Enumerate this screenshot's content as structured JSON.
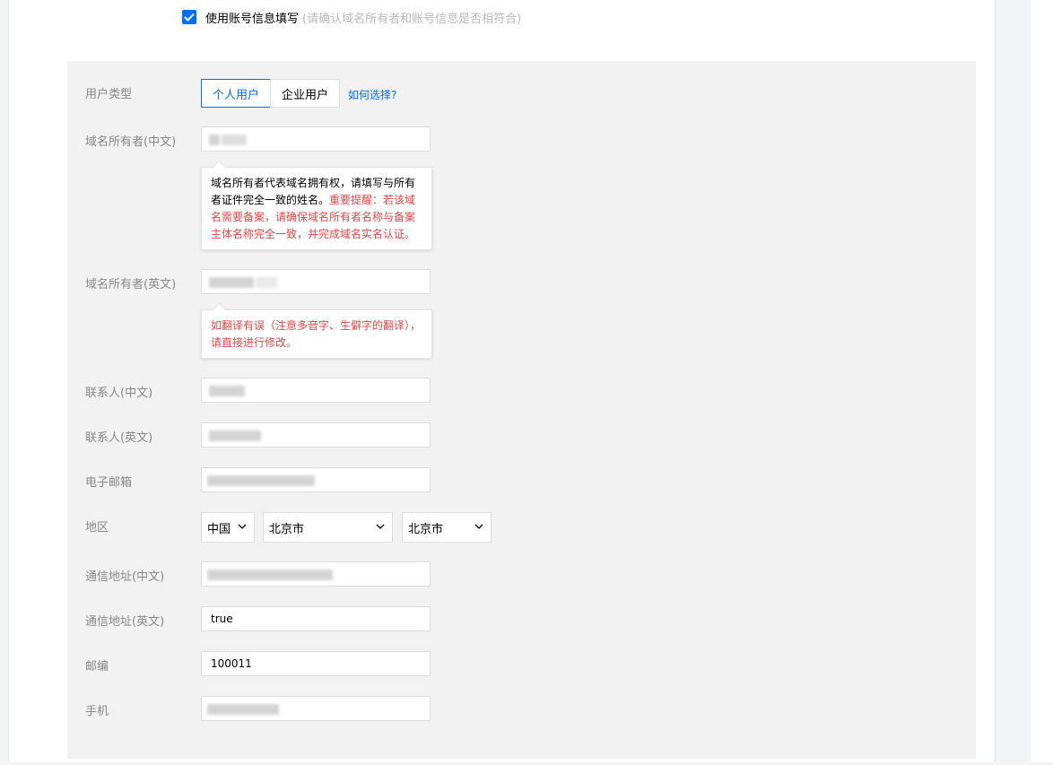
{
  "agreement": {
    "checked": true,
    "label": "使用账号信息填写",
    "hint": "(请确认域名所有者和账号信息是否相符合)"
  },
  "user_type": {
    "label": "用户类型",
    "options": [
      "个人用户",
      "企业用户"
    ],
    "selected": "个人用户",
    "help_link": "如何选择?"
  },
  "owner_cn": {
    "label": "域名所有者(中文)",
    "value": "",
    "tip_normal": "域名所有者代表域名拥有权，请填写与所有者证件完全一致的姓名。",
    "tip_warning": "重要提醒：若该域名需要备案，请确保域名所有者名称与备案主体名称完全一致，并完成域名实名认证。"
  },
  "owner_en": {
    "label": "域名所有者(英文)",
    "value": "",
    "tip_warning": "如翻译有误（注意多音字、生僻字的翻译），请直接进行修改。"
  },
  "contact_cn": {
    "label": "联系人(中文)",
    "value": ""
  },
  "contact_en": {
    "label": "联系人(英文)",
    "value": ""
  },
  "email": {
    "label": "电子邮箱",
    "value": ""
  },
  "region": {
    "label": "地区",
    "country": "中国",
    "province": "北京市",
    "city": "北京市"
  },
  "address_cn": {
    "label": "通信地址(中文)",
    "value": ""
  },
  "address_en": {
    "label": "通信地址(英文)",
    "value": "true"
  },
  "postcode": {
    "label": "邮编",
    "value": "100011"
  },
  "mobile": {
    "label": "手机",
    "value": ""
  },
  "colors": {
    "accent": "#006eff",
    "warning": "#e54545",
    "panel_bg": "#f2f2f2"
  }
}
